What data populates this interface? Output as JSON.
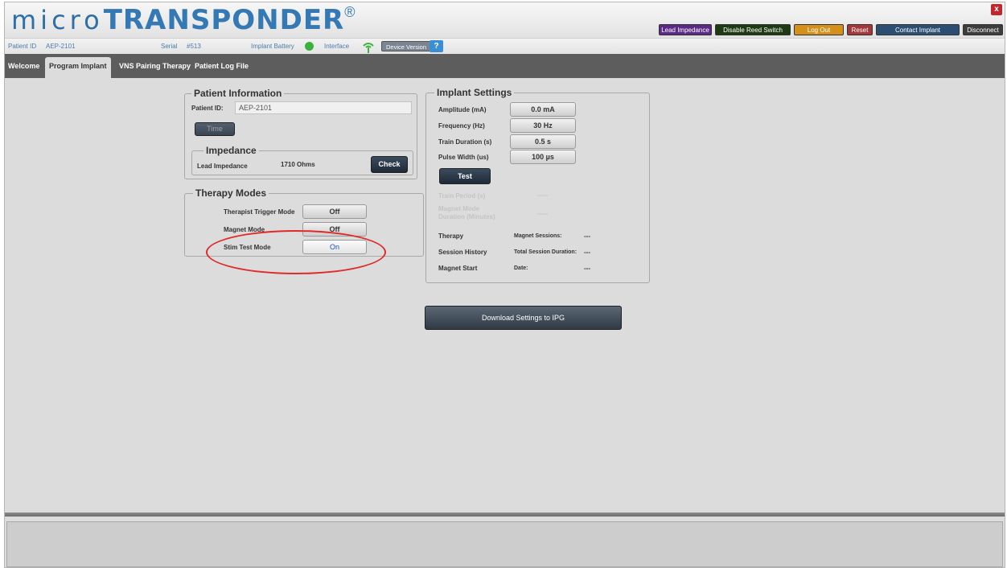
{
  "header": {
    "logo_micro": "micro",
    "logo_trans": "TRANSPONDER",
    "logo_reg": "®",
    "buttons": [
      {
        "label": "Lead Impedance",
        "color": "#5b2a86"
      },
      {
        "label": "Disable Reed Switch",
        "color": "#1d3a12"
      },
      {
        "label": "Log Out",
        "color": "#d5901c"
      },
      {
        "label": "Reset",
        "color": "#a3383b"
      },
      {
        "label": "Contact Implant",
        "color": "#2c4e73"
      },
      {
        "label": "Disconnect",
        "color": "#3d3d3d"
      }
    ],
    "close_label": "x"
  },
  "infobar": {
    "patient_label": "Patient ID",
    "patient_value": "AEP-2101",
    "serial_label": "Serial",
    "serial_value": "#513",
    "battery_label": "Implant Battery",
    "interface_label": "Interface",
    "device_version": "Device Version",
    "help": "?"
  },
  "tabs": [
    {
      "label": "Welcome",
      "active": false
    },
    {
      "label": "Program Implant",
      "active": true
    },
    {
      "label": "VNS Pairing Therapy",
      "active": false
    },
    {
      "label": "Patient Log File",
      "active": false
    }
  ],
  "patient_info": {
    "legend": "Patient Information",
    "patient_id_label": "Patient ID:",
    "patient_id_value": "AEP-2101",
    "time_button": "Time"
  },
  "impedance": {
    "legend": "Impedance",
    "lead_label": "Lead Impedance",
    "lead_value": "1710 Ohms",
    "check_button": "Check"
  },
  "therapy_modes": {
    "legend": "Therapy Modes",
    "modes": [
      {
        "label": "Therapist Trigger Mode",
        "value": "Off"
      },
      {
        "label": "Magnet Mode",
        "value": "Off"
      },
      {
        "label": "Stim Test Mode",
        "value": "On"
      }
    ]
  },
  "implant_settings": {
    "legend": "Implant Settings",
    "rows": [
      {
        "label": "Amplitude (mA)",
        "value": "0.0 mA"
      },
      {
        "label": "Frequency (Hz)",
        "value": "30 Hz"
      },
      {
        "label": "Train Duration (s)",
        "value": "0.5 s"
      },
      {
        "label": "Pulse Width (us)",
        "value": "100 µs"
      }
    ],
    "test_button": "Test",
    "train_period_label": "Train Period (s)",
    "train_period_value": "-----",
    "magnet_duration_label": "Magnet Mode Duration (Minutes)",
    "magnet_duration_value": "-----",
    "therapy_label": "Therapy",
    "magnet_sessions_label": "Magnet Sessions:",
    "magnet_sessions_value": "---",
    "session_history_label": "Session History",
    "total_duration_label": "Total Session Duration:",
    "total_duration_value": "---",
    "magnet_start_label": "Magnet Start",
    "date_label": "Date:",
    "date_value": "---"
  },
  "download_button": "Download Settings to IPG"
}
